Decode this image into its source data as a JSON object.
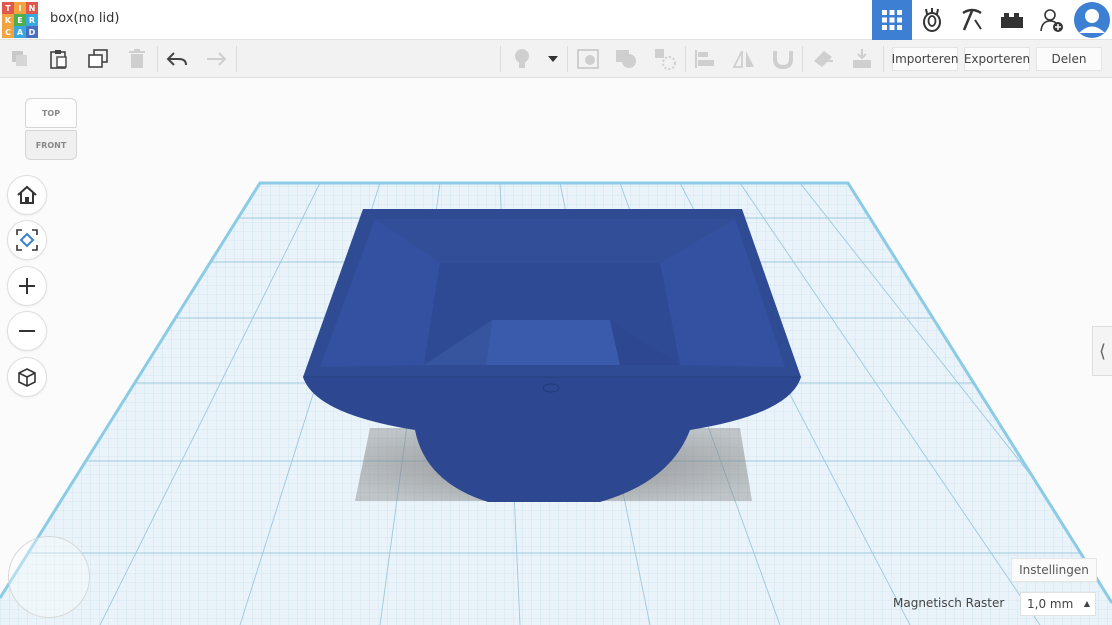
{
  "app": {
    "logo_letters": [
      "T",
      "I",
      "N",
      "K",
      "E",
      "R",
      "C",
      "A",
      "D"
    ],
    "logo_colors": [
      "#e2574c",
      "#f2a340",
      "#e2574c",
      "#f2a340",
      "#4cae4c",
      "#38a9df",
      "#f2a340",
      "#38a9df",
      "#4a6fbf"
    ],
    "document_title": "box(no lid)"
  },
  "topnav": {
    "items": [
      {
        "name": "3d-view-grid-icon",
        "active": true
      },
      {
        "name": "circuits-icon",
        "active": false
      },
      {
        "name": "pickaxe-icon",
        "active": false
      },
      {
        "name": "brick-icon",
        "active": false
      },
      {
        "name": "add-user-icon",
        "active": false
      }
    ],
    "accent": "#3d7fd3"
  },
  "toolbar": {
    "import_label": "Importeren",
    "export_label": "Exporteren",
    "share_label": "Delen"
  },
  "viewcube": {
    "top_label": "TOP",
    "front_label": "FRONT"
  },
  "footer": {
    "settings_label": "Instellingen",
    "snap_grid_label": "Magnetisch Raster",
    "snap_grid_value": "1,0 mm"
  },
  "model": {
    "color": "#2f4b94",
    "name": "box"
  }
}
